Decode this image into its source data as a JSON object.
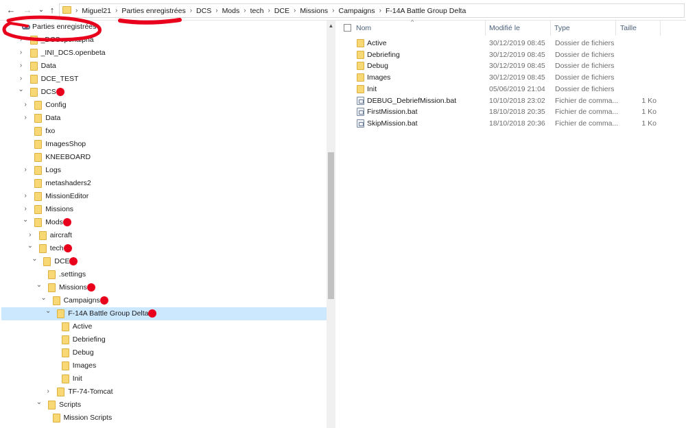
{
  "address_bar": {
    "back_icon": "←",
    "forward_icon": "→",
    "recent_icon": "⌄",
    "up_icon": "↑",
    "crumbs": [
      "Miguel21",
      "Parties enregistrées",
      "DCS",
      "Mods",
      "tech",
      "DCE",
      "Missions",
      "Campaigns",
      "F-14A Battle Group Delta"
    ]
  },
  "tree": {
    "items": [
      {
        "label": "Parties enregistrées",
        "level": 0,
        "state": "none",
        "icon": "saved-games-icon"
      },
      {
        "label": "_DCSopenalpha",
        "level": 1,
        "state": "collapsed"
      },
      {
        "label": "_INI_DCS.openbeta",
        "level": 1,
        "state": "collapsed"
      },
      {
        "label": "Data",
        "level": 1,
        "state": "collapsed"
      },
      {
        "label": "DCE_TEST",
        "level": 1,
        "state": "collapsed"
      },
      {
        "label": "DCS",
        "level": 1,
        "state": "expanded"
      },
      {
        "label": "Config",
        "level": 2,
        "state": "collapsed"
      },
      {
        "label": "Data",
        "level": 2,
        "state": "collapsed"
      },
      {
        "label": "fxo",
        "level": 2,
        "state": "none"
      },
      {
        "label": "ImagesShop",
        "level": 2,
        "state": "none"
      },
      {
        "label": "KNEEBOARD",
        "level": 2,
        "state": "none"
      },
      {
        "label": "Logs",
        "level": 2,
        "state": "collapsed"
      },
      {
        "label": "metashaders2",
        "level": 2,
        "state": "none"
      },
      {
        "label": "MissionEditor",
        "level": 2,
        "state": "collapsed"
      },
      {
        "label": "Missions",
        "level": 2,
        "state": "collapsed"
      },
      {
        "label": "Mods",
        "level": 2,
        "state": "expanded"
      },
      {
        "label": "aircraft",
        "level": 3,
        "state": "collapsed"
      },
      {
        "label": "tech",
        "level": 3,
        "state": "expanded"
      },
      {
        "label": "DCE",
        "level": 4,
        "state": "expanded"
      },
      {
        "label": ".settings",
        "level": 5,
        "state": "none"
      },
      {
        "label": "Missions",
        "level": 5,
        "state": "expanded"
      },
      {
        "label": "Campaigns",
        "level": 6,
        "state": "expanded"
      },
      {
        "label": "F-14A Battle Group Delta",
        "level": 7,
        "state": "expanded",
        "selected": true
      },
      {
        "label": "Active",
        "level": 8,
        "state": "none"
      },
      {
        "label": "Debriefing",
        "level": 8,
        "state": "none"
      },
      {
        "label": "Debug",
        "level": 8,
        "state": "none"
      },
      {
        "label": "Images",
        "level": 8,
        "state": "none"
      },
      {
        "label": "Init",
        "level": 8,
        "state": "none"
      },
      {
        "label": "TF-74-Tomcat",
        "level": 7,
        "state": "collapsed"
      },
      {
        "label": "Scripts",
        "level": 5,
        "state": "expanded"
      },
      {
        "label": "Mission Scripts",
        "level": 6,
        "state": "none"
      }
    ]
  },
  "file_list": {
    "headers": {
      "name": "Nom",
      "modified": "Modifié le",
      "type": "Type",
      "size": "Taille"
    },
    "sort_indicator": "^",
    "rows": [
      {
        "name": "Active",
        "modified": "30/12/2019 08:45",
        "type": "Dossier de fichiers",
        "size": "",
        "kind": "folder"
      },
      {
        "name": "Debriefing",
        "modified": "30/12/2019 08:45",
        "type": "Dossier de fichiers",
        "size": "",
        "kind": "folder"
      },
      {
        "name": "Debug",
        "modified": "30/12/2019 08:45",
        "type": "Dossier de fichiers",
        "size": "",
        "kind": "folder"
      },
      {
        "name": "Images",
        "modified": "30/12/2019 08:45",
        "type": "Dossier de fichiers",
        "size": "",
        "kind": "folder"
      },
      {
        "name": "Init",
        "modified": "05/06/2019 21:04",
        "type": "Dossier de fichiers",
        "size": "",
        "kind": "folder"
      },
      {
        "name": "DEBUG_DebriefMission.bat",
        "modified": "10/10/2018 23:02",
        "type": "Fichier de comma...",
        "size": "1 Ko",
        "kind": "bat"
      },
      {
        "name": "FirstMission.bat",
        "modified": "18/10/2018 20:35",
        "type": "Fichier de comma...",
        "size": "1 Ko",
        "kind": "bat"
      },
      {
        "name": "SkipMission.bat",
        "modified": "18/10/2018 20:36",
        "type": "Fichier de comma...",
        "size": "1 Ko",
        "kind": "bat"
      }
    ]
  },
  "colors": {
    "selection": "#cce8ff",
    "folder": "#f8d775",
    "annotation_red": "#e8001c",
    "header_text": "#4c607a"
  }
}
